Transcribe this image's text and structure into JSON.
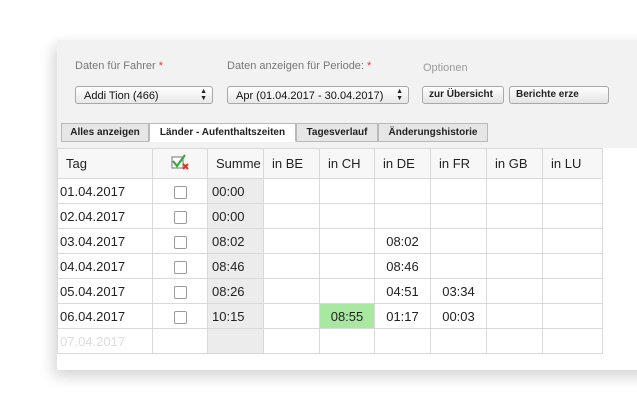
{
  "filters": {
    "driver_label": "Daten für Fahrer",
    "period_label": "Daten anzeigen für Periode:",
    "required_mark": "*",
    "options_label": "Optionen",
    "driver_value": "Addi Tion (466)",
    "period_value": "Apr (01.04.2017 - 30.04.2017)",
    "overview_button": "zur Übersicht",
    "reports_button": "Berichte erze"
  },
  "tabs": [
    {
      "label": "Alles anzeigen",
      "active": false
    },
    {
      "label": "Länder - Aufenthaltszeiten",
      "active": true
    },
    {
      "label": "Tagesverlauf",
      "active": false
    },
    {
      "label": "Änderungshistorie",
      "active": false
    }
  ],
  "table": {
    "headers": [
      "Tag",
      "",
      "Summe",
      "in BE",
      "in CH",
      "in DE",
      "in FR",
      "in GB",
      "in LU"
    ],
    "rows": [
      {
        "date": "01.04.2017",
        "sum": "00:00",
        "BE": "",
        "CH": "",
        "DE": "",
        "FR": "",
        "GB": ""
      },
      {
        "date": "02.04.2017",
        "sum": "00:00",
        "BE": "",
        "CH": "",
        "DE": "",
        "FR": "",
        "GB": ""
      },
      {
        "date": "03.04.2017",
        "sum": "08:02",
        "BE": "",
        "CH": "",
        "DE": "08:02",
        "FR": "",
        "GB": ""
      },
      {
        "date": "04.04.2017",
        "sum": "08:46",
        "BE": "",
        "CH": "",
        "DE": "08:46",
        "FR": "",
        "GB": ""
      },
      {
        "date": "05.04.2017",
        "sum": "08:26",
        "BE": "",
        "CH": "",
        "DE": "04:51",
        "FR": "03:34",
        "GB": ""
      },
      {
        "date": "06.04.2017",
        "sum": "10:15",
        "BE": "",
        "CH": "08:55",
        "DE": "01:17",
        "FR": "00:03",
        "GB": ""
      }
    ],
    "partial_row_date": "07.04.2017"
  },
  "colors": {
    "highlight": "#a8e8a0",
    "required": "#e03a3a"
  },
  "icons": {
    "header_checkbox": "checkbox-check-x-icon"
  }
}
